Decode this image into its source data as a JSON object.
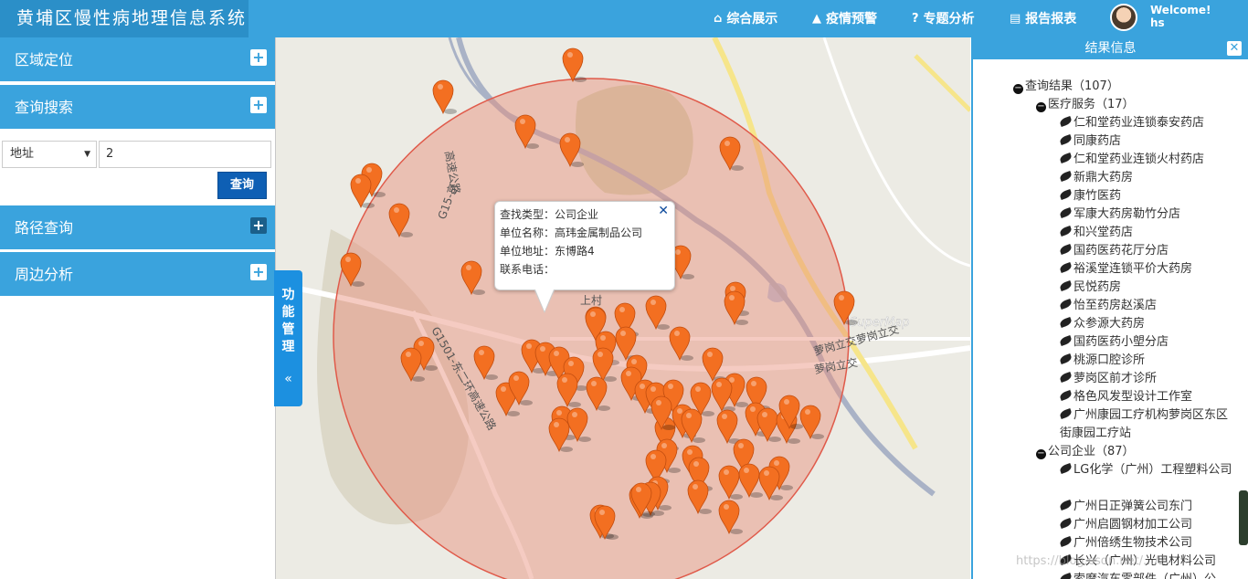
{
  "header": {
    "title": "黄埔区慢性病地理信息系统",
    "nav": [
      {
        "icon": "home-icon",
        "label": "综合展示"
      },
      {
        "icon": "warning-icon",
        "label": "疫情预警"
      },
      {
        "icon": "question-icon",
        "label": "专题分析"
      },
      {
        "icon": "report-icon",
        "label": "报告报表"
      }
    ],
    "welcome": "Welcome!",
    "user": "hs"
  },
  "left": {
    "sections": [
      "区域定位",
      "查询搜索",
      "路径查询",
      "周边分析"
    ],
    "search": {
      "select_value": "地址",
      "input_value": "2",
      "button": "查询"
    }
  },
  "side_tab": {
    "label": "功能管理",
    "arrow": "«"
  },
  "popup": {
    "rows": [
      {
        "k": "查找类型：",
        "v": "公司企业"
      },
      {
        "k": "单位名称：",
        "v": "高玮金属制品公司"
      },
      {
        "k": "单位地址：",
        "v": "东博路4"
      },
      {
        "k": "联系电话：",
        "v": ""
      }
    ]
  },
  "map_labels": [
    "G15-京",
    "高速公路",
    "G1501-东二环高速公路",
    "萝岗立交萝岗立交",
    "萝岗立交",
    "SuperMap",
    "上村"
  ],
  "results": {
    "title": "结果信息",
    "root": "查询结果（107）",
    "groups": [
      {
        "name": "医疗服务（17）",
        "items": [
          "仁和堂药业连锁泰安药店",
          "同康药店",
          "仁和堂药业连锁火村药店",
          "新鼎大药房",
          "康竹医药",
          "军康大药房勒竹分店",
          "和兴堂药店",
          "国药医药花厅分店",
          "裕溪堂连锁平价大药房",
          "民悦药房",
          "怡至药房赵溪店",
          "众参源大药房",
          "国药医药小塱分店",
          "桃源口腔诊所",
          "萝岗区前才诊所",
          "格色风发型设计工作室",
          "广州康园工疗机构萝岗区东区街康园工疗站"
        ]
      },
      {
        "name": "公司企业（87）",
        "items": [
          "LG化学（广州）工程塑料公司",
          "广州日正弹簧公司东门",
          "广州启圆钢材加工公司",
          "广州倍绣生物技术公司",
          "长兴（广州）光电材料公司",
          "索摩汽车零部件（广州）公"
        ]
      }
    ]
  },
  "watermark": "https://blog.csdn.net/.../2",
  "colors": {
    "header": "#3aa3dd",
    "brand": "#2b8fc8",
    "marker": "#f36f21",
    "buffer": "#e8a08f"
  }
}
